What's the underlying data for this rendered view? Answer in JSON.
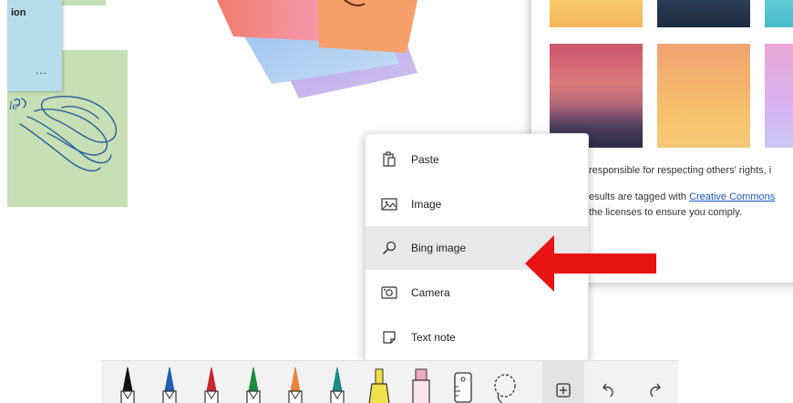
{
  "canvas": {
    "note_title": "ion",
    "note_more": "...",
    "doodle_text": "le"
  },
  "bing_panel": {
    "disclaimer": "responsible for respecting others' rights, i",
    "line2_prefix": "esults are tagged with ",
    "line2_link": "Creative Commons",
    "line3": "the licenses to ensure you comply."
  },
  "context_menu": {
    "items": [
      {
        "label": "Paste",
        "icon": "paste-icon"
      },
      {
        "label": "Image",
        "icon": "image-icon"
      },
      {
        "label": "Bing image",
        "icon": "search-icon"
      },
      {
        "label": "Camera",
        "icon": "camera-icon"
      },
      {
        "label": "Text note",
        "icon": "text-note-icon"
      }
    ],
    "highlighted": "Bing image"
  },
  "annotation": {
    "arrow_color": "#e81313"
  },
  "toolbar": {
    "tools": [
      {
        "name": "black-pen",
        "color": "#111111"
      },
      {
        "name": "blue-pen",
        "color": "#1f5fb3"
      },
      {
        "name": "red-pen",
        "color": "#c62828"
      },
      {
        "name": "green-pen",
        "color": "#1e8a3c"
      },
      {
        "name": "orange-pen",
        "color": "#e8843a"
      },
      {
        "name": "teal-pen",
        "color": "#1c8c84"
      },
      {
        "name": "yellow-highlighter",
        "color": "#f0e14a"
      },
      {
        "name": "pink-highlighter",
        "color": "#f0a7c9"
      },
      {
        "name": "ruler",
        "color": "#333333"
      },
      {
        "name": "lasso-select",
        "color": "#333333"
      },
      {
        "name": "add",
        "color": "#333333"
      },
      {
        "name": "undo",
        "color": "#333333"
      },
      {
        "name": "redo",
        "color": "#333333"
      }
    ],
    "active_tool": "add"
  }
}
